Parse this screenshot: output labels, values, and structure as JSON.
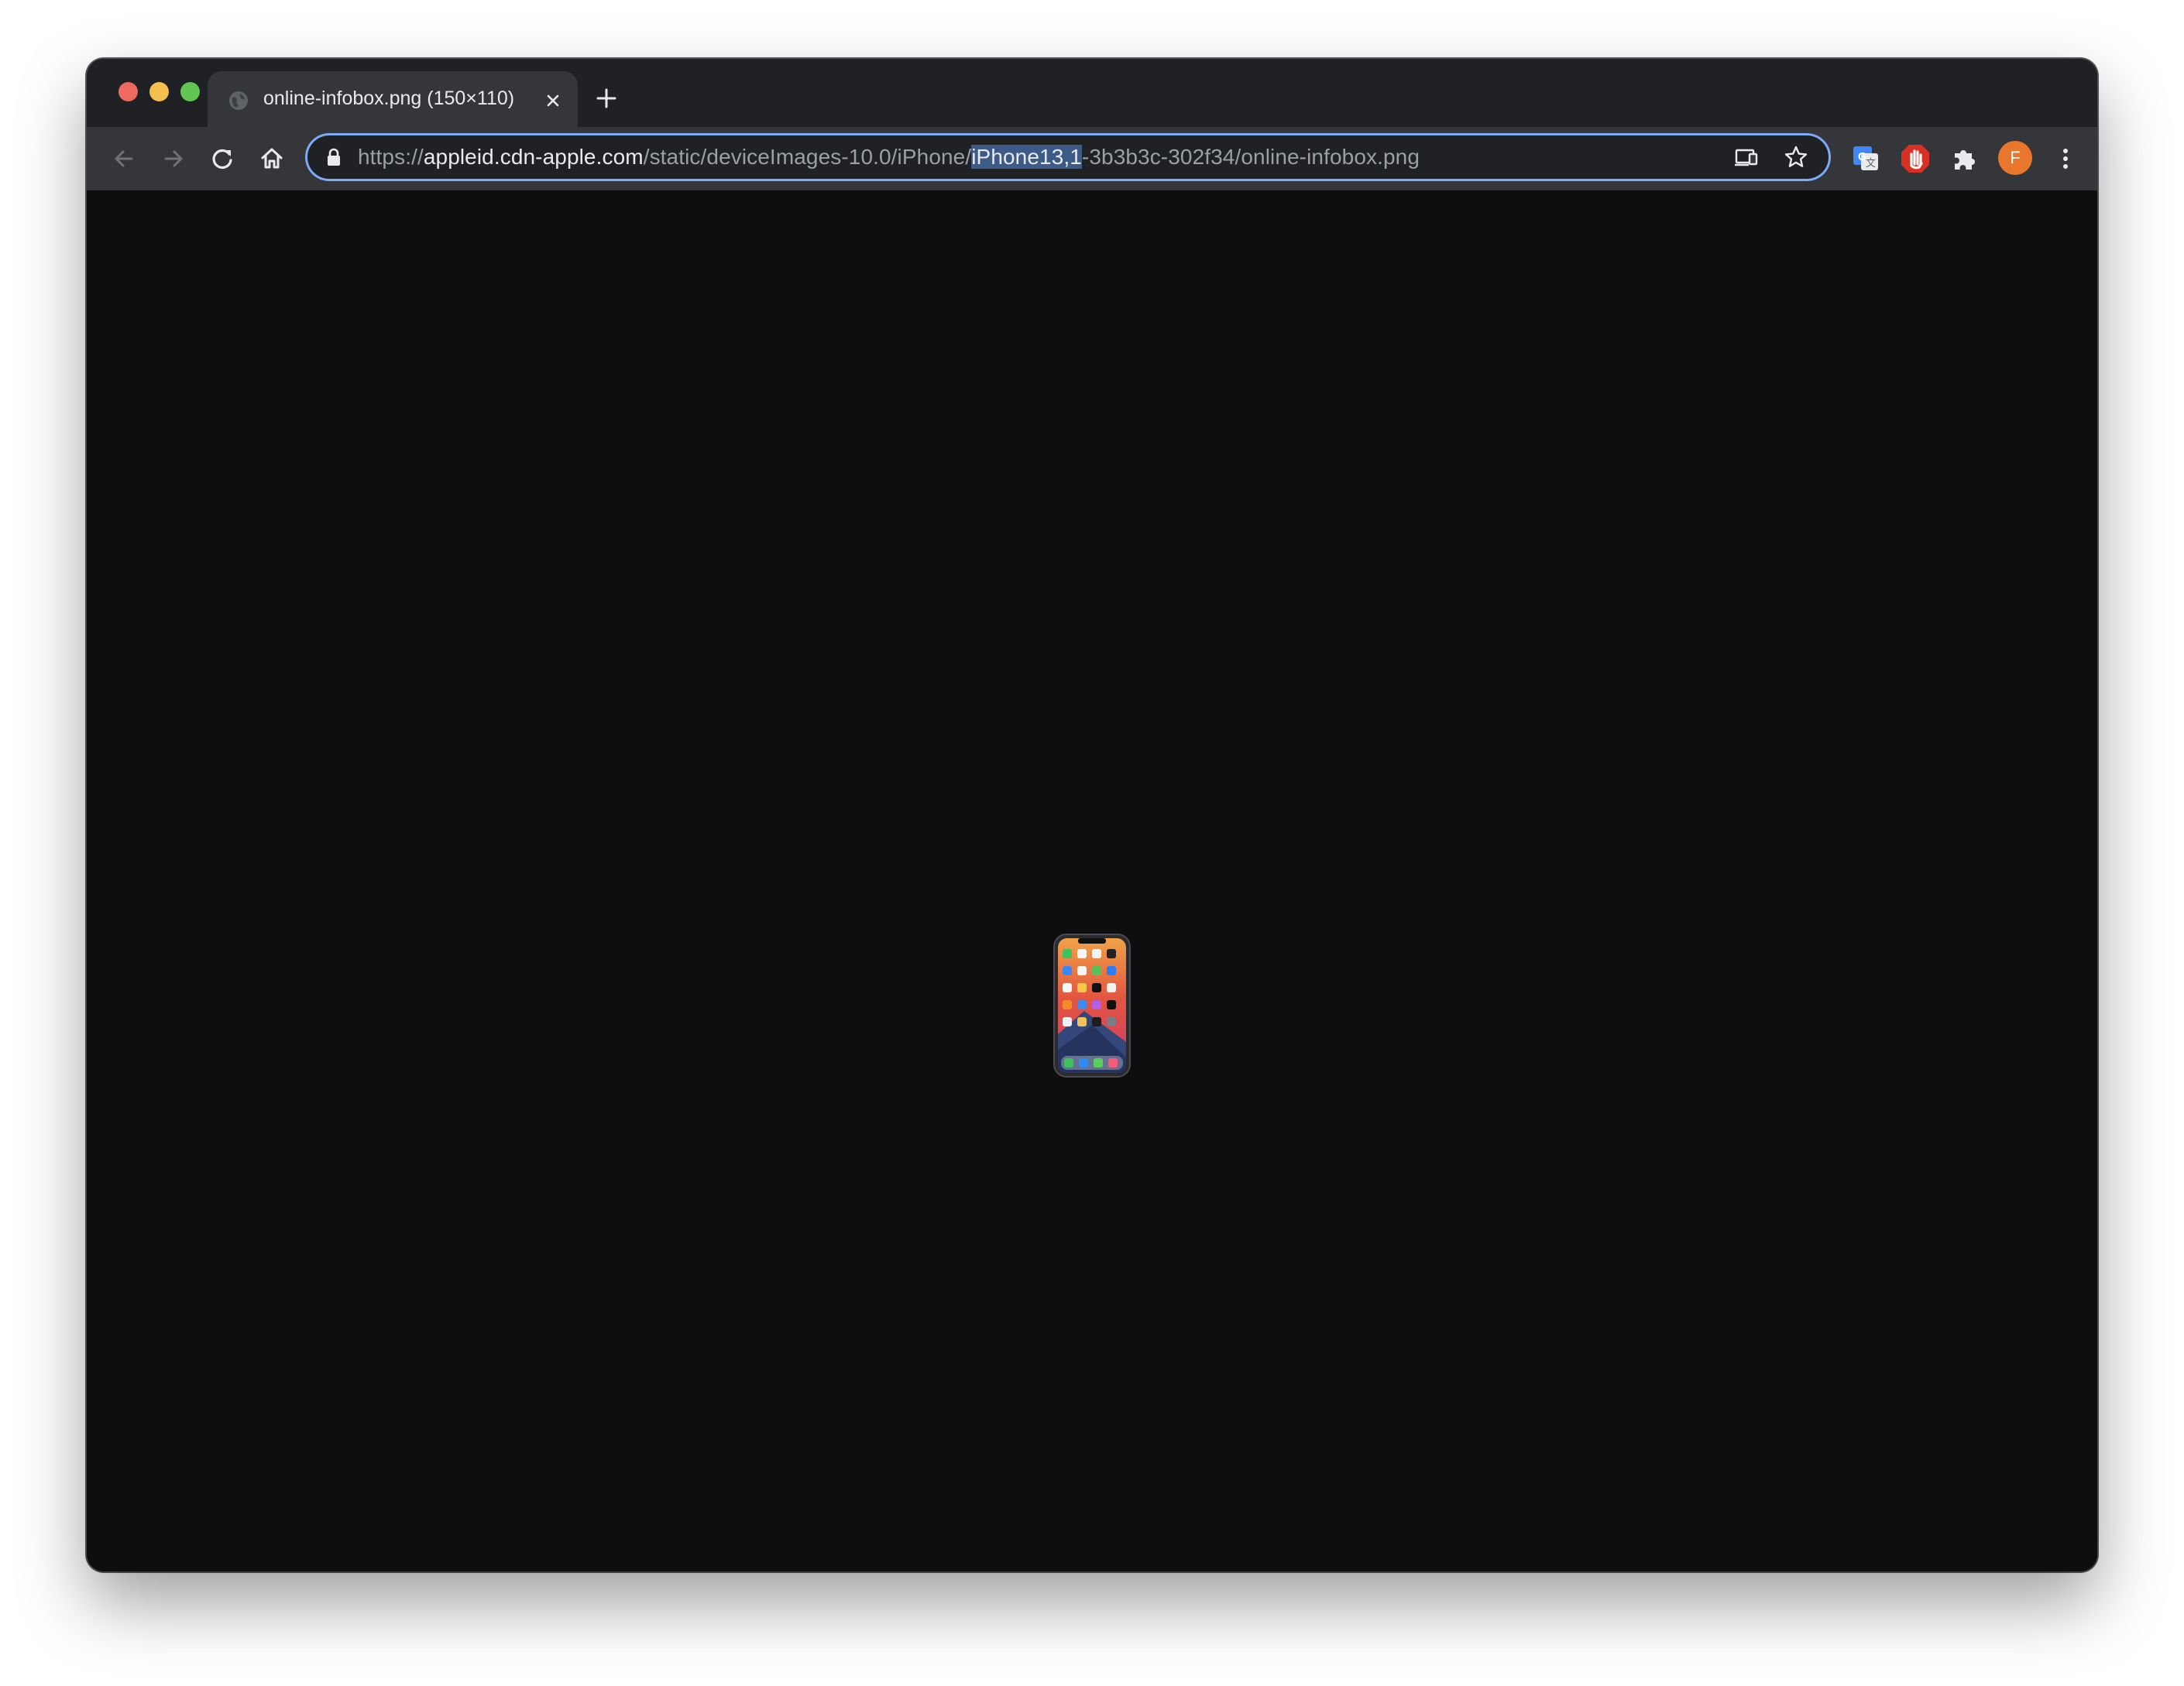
{
  "window": {
    "traffic_lights": [
      "close",
      "minimize",
      "maximize"
    ]
  },
  "tab": {
    "title": "online-infobox.png (150×110)",
    "favicon": "globe-icon",
    "close_icon": "close-icon"
  },
  "new_tab_icon": "plus-icon",
  "toolbar": {
    "back_icon": "arrow-left-icon",
    "forward_icon": "arrow-right-icon",
    "reload_icon": "reload-icon",
    "home_icon": "home-icon"
  },
  "omnibox": {
    "scheme": "https://",
    "host": "appleid.cdn-apple.com",
    "path_before_selection": "/static/deviceImages-10.0/iPhone/",
    "selected_text": "iPhone13,1",
    "path_after_selection": "-3b3b3c-302f34/online-infobox.png",
    "lock_icon": "lock-icon",
    "cast_icon": "cast-icon",
    "bookmark_icon": "star-icon"
  },
  "extensions": {
    "translate_icon": "google-translate-icon",
    "adblock_icon": "stop-hand-icon",
    "puzzle_icon": "extensions-puzzle-icon",
    "menu_icon": "vertical-dots-icon"
  },
  "profile": {
    "initial": "F",
    "color": "#e8762c"
  },
  "content": {
    "image_description": "iphone-device-image",
    "background": "#0e0e0f"
  }
}
